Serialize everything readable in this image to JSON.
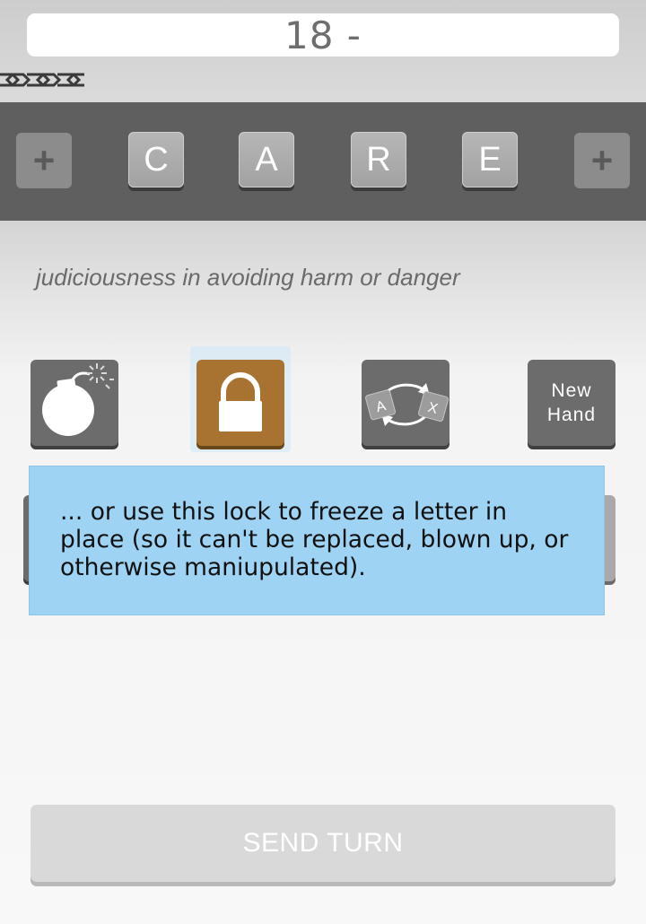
{
  "score": {
    "text": "18 -"
  },
  "icons": {
    "chain": "chain-link-icon",
    "bomb": "bomb-icon",
    "lock": "padlock-icon",
    "swap": "swap-letters-icon",
    "add": "plus-icon"
  },
  "word": {
    "add_before": "+",
    "letters": [
      "C",
      "A",
      "R",
      "E"
    ],
    "add_after": "+"
  },
  "definition": "judiciousness in avoiding harm or danger",
  "powerups": {
    "swap_from": "A",
    "swap_to": "X",
    "new_hand_line1": "New",
    "new_hand_line2": "Hand"
  },
  "tooltip": {
    "text": "... or use this lock to freeze a letter in place (so it can't be replaced, blown up, or otherwise maniupulated)."
  },
  "send_turn": {
    "label": "SEND TURN"
  },
  "colors": {
    "strip": "#5f5f5f",
    "lock_button": "#a87330",
    "tooltip_bg": "#9fd3f3",
    "power_button": "#6c6c6c"
  }
}
